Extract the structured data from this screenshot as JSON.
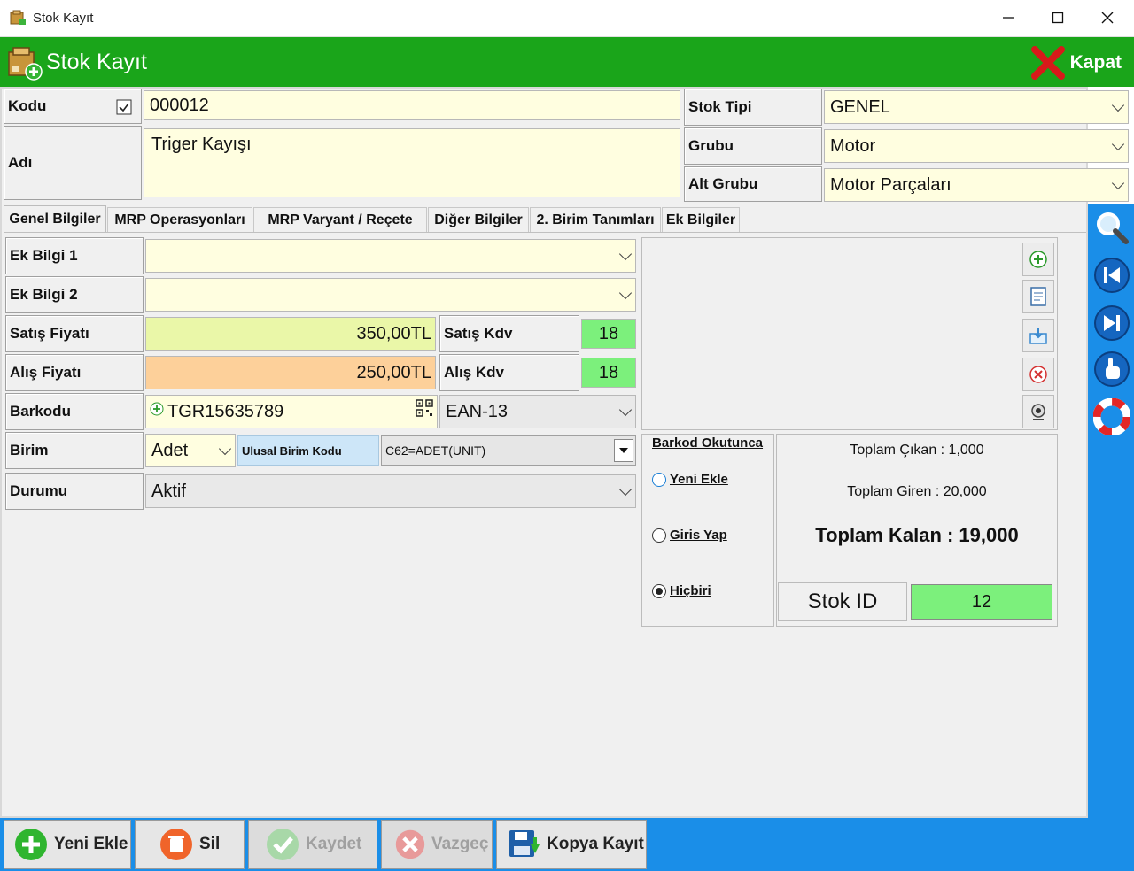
{
  "window": {
    "title": "Stok Kayıt",
    "minimize": "—",
    "maximize": "☐",
    "close": "✕"
  },
  "header": {
    "title": "Stok Kayıt",
    "close_label": "Kapat"
  },
  "form": {
    "kodu_label": "Kodu",
    "kodu_value": "000012",
    "adi_label": "Adı",
    "adi_value": "Triger Kayışı",
    "stok_tipi_label": "Stok Tipi",
    "stok_tipi_value": "GENEL",
    "grubu_label": "Grubu",
    "grubu_value": "Motor",
    "alt_grubu_label": "Alt Grubu",
    "alt_grubu_value": "Motor Parçaları"
  },
  "tabs": [
    {
      "label": "Genel Bilgiler"
    },
    {
      "label": "MRP Operasyonları"
    },
    {
      "label": "MRP Varyant / Reçete"
    },
    {
      "label": "Diğer Bilgiler"
    },
    {
      "label": "2. Birim Tanımları"
    },
    {
      "label": "Ek Bilgiler"
    }
  ],
  "general": {
    "ek_bilgi_1_label": "Ek Bilgi 1",
    "ek_bilgi_1_value": "",
    "ek_bilgi_2_label": "Ek Bilgi 2",
    "ek_bilgi_2_value": "",
    "satis_fiyati_label": "Satış Fiyatı",
    "satis_fiyati_value": "350,00TL",
    "satis_kdv_label": "Satış Kdv",
    "satis_kdv_value": "18",
    "alis_fiyati_label": "Alış Fiyatı",
    "alis_fiyati_value": "250,00TL",
    "alis_kdv_label": "Alış Kdv",
    "alis_kdv_value": "18",
    "barkodu_label": "Barkodu",
    "barkodu_value": "TGR15635789",
    "barkod_type": "EAN-13",
    "birim_label": "Birim",
    "birim_value": "Adet",
    "ulusal_birim_label": "Ulusal Birim Kodu",
    "ulusal_birim_value": "C62=ADET(UNIT)",
    "durumu_label": "Durumu",
    "durumu_value": "Aktif"
  },
  "barkod_okutunca": {
    "title": "Barkod Okutunca",
    "options": [
      "Yeni Ekle",
      "Giris Yap",
      "Hiçbiri"
    ],
    "selected": "Hiçbiri"
  },
  "stok_summary": {
    "toplam_cikan": "Toplam Çıkan : 1,000",
    "toplam_giren": "Toplam Giren : 20,000",
    "toplam_kalan": "Toplam Kalan : 19,000",
    "stok_id_label": "Stok ID",
    "stok_id_value": "12"
  },
  "bottom": {
    "yeni_ekle": "Yeni Ekle",
    "sil": "Sil",
    "kaydet": "Kaydet",
    "vazgec": "Vazgeç",
    "kopya_kayit": "Kopya Kayıt"
  },
  "colors": {
    "header_green": "#1aa51a",
    "nav_blue": "#1a8ee8",
    "field_yellow": "#fffee0",
    "price_green": "#eaf7a8",
    "price_orange": "#fdd09a",
    "kdv_green": "#7cf07c"
  }
}
